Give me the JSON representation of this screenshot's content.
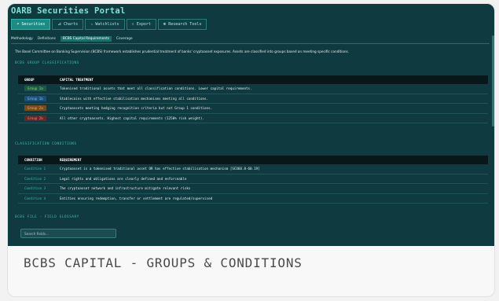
{
  "portal_title": "OARB Securities Portal",
  "toolbar": [
    {
      "icon": "⌕",
      "label": "Securities",
      "active": true,
      "icon_name": "search-icon"
    },
    {
      "icon": "⊿",
      "label": "Charts",
      "active": false,
      "icon_name": "chart-icon"
    },
    {
      "icon": "☆",
      "label": "Watchlists",
      "active": false,
      "icon_name": "star-icon"
    },
    {
      "icon": "⇩",
      "label": "Export",
      "active": false,
      "icon_name": "export-icon"
    },
    {
      "icon": "⊛",
      "label": "Research Tools",
      "active": false,
      "icon_name": "research-icon"
    }
  ],
  "subtabs": [
    {
      "label": "Methodology",
      "active": false
    },
    {
      "label": "Definitions",
      "active": false
    },
    {
      "label": "BCBS Capital Requirements",
      "active": true
    },
    {
      "label": "Coverage",
      "active": false
    }
  ],
  "intro": "The Basel Committee on Banking Supervision (BCBS) framework establishes prudential treatment of banks' cryptoasset exposures. Assets are classified into groups based on meeting specific conditions.",
  "groups_section": {
    "title": "BCBS GROUP CLASSIFICATIONS",
    "headers": [
      "GROUP",
      "CAPITAL TREATMENT"
    ],
    "rows": [
      {
        "group": "Group 1a",
        "treatment": "Tokenised traditional assets that meet all classification conditions. Lower capital requirements.",
        "bg": "#1f5a3c",
        "fg": "#7fe08a"
      },
      {
        "group": "Group 1b",
        "treatment": "Stablecoins with effective stabilisation mechanisms meeting all conditions.",
        "bg": "#1d4f78",
        "fg": "#7fc0f0"
      },
      {
        "group": "Group 2a",
        "treatment": "Cryptoassets meeting hedging recognition criteria but not Group 1 conditions.",
        "bg": "#7a4a1c",
        "fg": "#f0b264"
      },
      {
        "group": "Group 2b",
        "treatment": "All other cryptoassets. Highest capital requirements (1250% risk weight).",
        "bg": "#6e2424",
        "fg": "#f08c82"
      }
    ]
  },
  "conditions_section": {
    "title": "CLASSIFICATION CONDITIONS",
    "headers": [
      "CONDITION",
      "REQUIREMENT"
    ],
    "rows": [
      {
        "condition": "Condition 1",
        "requirement": "Cryptoasset is a tokenised traditional asset OR has effective stabilisation mechanism [SCO60.8-60.19]"
      },
      {
        "condition": "Condition 2",
        "requirement": "Legal rights and obligations are clearly defined and enforceable"
      },
      {
        "condition": "Condition 3",
        "requirement": "The cryptoasset network and infrastructure mitigate relevant risks"
      },
      {
        "condition": "Condition 4",
        "requirement": "Entities ensuring redemption, transfer or settlement are regulated/supervised"
      }
    ]
  },
  "glossary": {
    "title": "BCBS FILE - FIELD GLOSSARY",
    "search_placeholder": "Search fields..."
  },
  "caption": "BCBS CAPITAL - GROUPS & CONDITIONS"
}
